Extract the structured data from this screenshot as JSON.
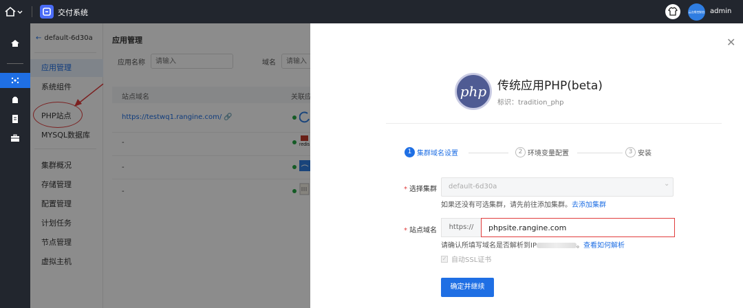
{
  "topbar": {
    "system_title": "交付系统",
    "avatar_text": "云边缘控制台",
    "username": "admin"
  },
  "leftnav": {
    "icons": [
      "home-icon",
      "cluster-icon",
      "bag-icon",
      "document-icon",
      "toolbox-icon"
    ],
    "active_index": 1
  },
  "subnav": {
    "back_label": "default-6d30a",
    "items": [
      {
        "label": "应用管理",
        "active": true
      },
      {
        "label": "系统组件",
        "active": false
      },
      {
        "label": "PHP站点",
        "active": false
      },
      {
        "label": "MYSQL数据库",
        "active": false
      },
      {
        "label": "集群概况",
        "active": false
      },
      {
        "label": "存储管理",
        "active": false
      },
      {
        "label": "配置管理",
        "active": false
      },
      {
        "label": "计划任务",
        "active": false
      },
      {
        "label": "节点管理",
        "active": false
      },
      {
        "label": "虚拟主机",
        "active": false
      }
    ]
  },
  "main": {
    "title": "应用管理",
    "filters": {
      "app_name_label": "应用名称",
      "app_name_placeholder": "请输入",
      "domain_label": "域名",
      "domain_placeholder": "请输入"
    },
    "table": {
      "columns": [
        "站点域名",
        "关联应"
      ],
      "rows": [
        {
          "domain": "https://testwq1.rangine.com/",
          "app": "loading"
        },
        {
          "domain": "-",
          "app": "redis"
        },
        {
          "domain": "-",
          "app": "docker"
        },
        {
          "domain": "-",
          "app": "mysql"
        }
      ]
    }
  },
  "drawer": {
    "app_logo_text": "php",
    "app_name": "传统应用PHP(beta)",
    "app_id": "标识：tradition_php",
    "steps": [
      {
        "num": "1",
        "label": "集群域名设置",
        "current": true
      },
      {
        "num": "2",
        "label": "环境变量配置",
        "current": false
      },
      {
        "num": "3",
        "label": "安装",
        "current": false
      }
    ],
    "cluster_label": "选择集群",
    "cluster_value": "default-6d30a",
    "cluster_hint": "如果还没有可选集群，请先前往添加集群。",
    "cluster_hint_link": "去添加集群",
    "domain_label": "站点域名",
    "domain_prefix": "https://",
    "domain_value": "phpsite.rangine.com",
    "domain_hint_prefix": "请确认所填写域名是否解析到IP",
    "domain_hint_link": "查看如何解析",
    "ssl_label": "自动SSL证书",
    "confirm_label": "确定并继续",
    "colors": {
      "primary": "#1f6fe4",
      "annotation": "#e03b3b",
      "topbar": "#22262e"
    }
  }
}
